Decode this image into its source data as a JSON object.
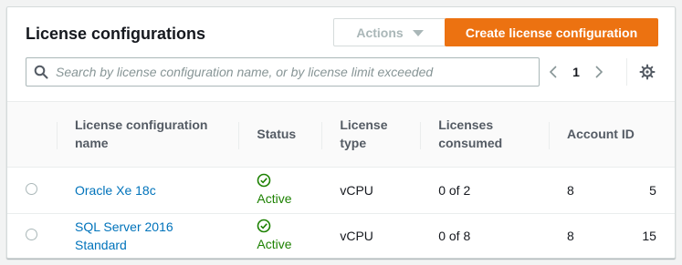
{
  "header": {
    "title": "License configurations",
    "actions_label": "Actions",
    "create_label": "Create license configuration"
  },
  "search": {
    "placeholder": "Search by license configuration name, or by license limit exceeded",
    "value": ""
  },
  "pagination": {
    "current_page": "1"
  },
  "icons": {
    "search": "search-icon",
    "prev": "chevron-left-icon",
    "next": "chevron-right-icon",
    "settings": "gear-icon",
    "status_ok": "check-circle-icon"
  },
  "colors": {
    "accent": "#ec7211",
    "link": "#0073bb",
    "success": "#1d8102"
  },
  "table": {
    "columns": [
      "License configuration name",
      "Status",
      "License type",
      "Licenses consumed",
      "Account ID"
    ],
    "rows": [
      {
        "name": "Oracle Xe 18c",
        "status": "Active",
        "license_type": "vCPU",
        "consumed": "0 of 2",
        "account_start": "8",
        "account_end": "5"
      },
      {
        "name": "SQL Server 2016 Standard",
        "status": "Active",
        "license_type": "vCPU",
        "consumed": "0 of 8",
        "account_start": "8",
        "account_end": "15"
      }
    ]
  }
}
